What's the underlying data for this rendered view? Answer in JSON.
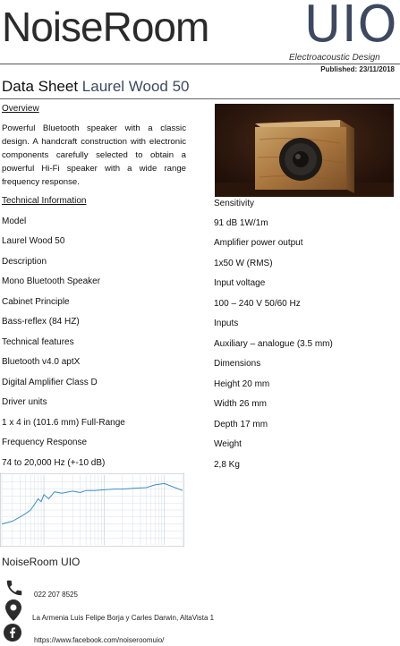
{
  "header": {
    "brand_left": "NoiseRoom",
    "brand_right": "UIO",
    "tagline": "Electroacoustic Design",
    "published": "Published: 23/11/2018"
  },
  "title": {
    "prefix": "Data Sheet",
    "product": "Laurel Wood 50"
  },
  "overview": {
    "heading": "Overview",
    "text": "Powerful Bluetooth speaker with a classic design. A handcraft construction with electronic components carefully selected to obtain a powerful Hi-Fi speaker with a wide range frequency response."
  },
  "technical": {
    "heading": "Technical Information",
    "left": [
      "Model",
      "Laurel Wood 50",
      "Description",
      "Mono Bluetooth Speaker",
      "Cabinet Principle",
      "Bass-reflex (84 HZ)",
      "Technical features",
      "Bluetooth v4.0 aptX",
      "Digital Amplifier Class D",
      "Driver units",
      "1 x 4 in (101.6 mm) Full-Range",
      "Frequency Response",
      "74 to 20,000 Hz (+-10 dB)"
    ],
    "right": [
      "Sensitivity",
      "91 dB 1W/1m",
      "Amplifier power output",
      "1x50 W (RMS)",
      "Input voltage",
      "100 – 240 V 50/60 Hz",
      "Inputs",
      "Auxiliary – analogue (3.5 mm)",
      "Dimensions",
      "Height 20 mm",
      "Width 26 mm",
      "Depth 17 mm",
      "Weight",
      "2,8 Kg"
    ]
  },
  "chart_data": {
    "type": "line",
    "title": "",
    "xlabel": "",
    "ylabel": "",
    "x_scale": "log",
    "xlim": [
      20,
      20000
    ],
    "grid": true,
    "series": [
      {
        "x": [
          20,
          30,
          40,
          50,
          60,
          70,
          80,
          90,
          100,
          120,
          150,
          200,
          300,
          400,
          500,
          700,
          1000,
          1500,
          2000,
          3000,
          5000,
          7000,
          10000,
          15000,
          20000
        ],
        "y": [
          0.3,
          0.34,
          0.4,
          0.45,
          0.5,
          0.58,
          0.66,
          0.62,
          0.72,
          0.66,
          0.76,
          0.74,
          0.77,
          0.75,
          0.78,
          0.78,
          0.79,
          0.8,
          0.8,
          0.81,
          0.82,
          0.86,
          0.88,
          0.82,
          0.78
        ]
      }
    ],
    "colors": {
      "line": "#3a8fc8",
      "grid": "#cfd6de"
    }
  },
  "footer": {
    "brand": "NoiseRoom UIO",
    "phone": "022 207 8525",
    "address": "La Armenia Luis Felipe Borja y Carles Darwin, AltaVista 1",
    "facebook": "https://www.facebook.com/noiseroomuio/"
  },
  "colors": {
    "accent": "#3d4960",
    "text": "#1a1a1a"
  }
}
